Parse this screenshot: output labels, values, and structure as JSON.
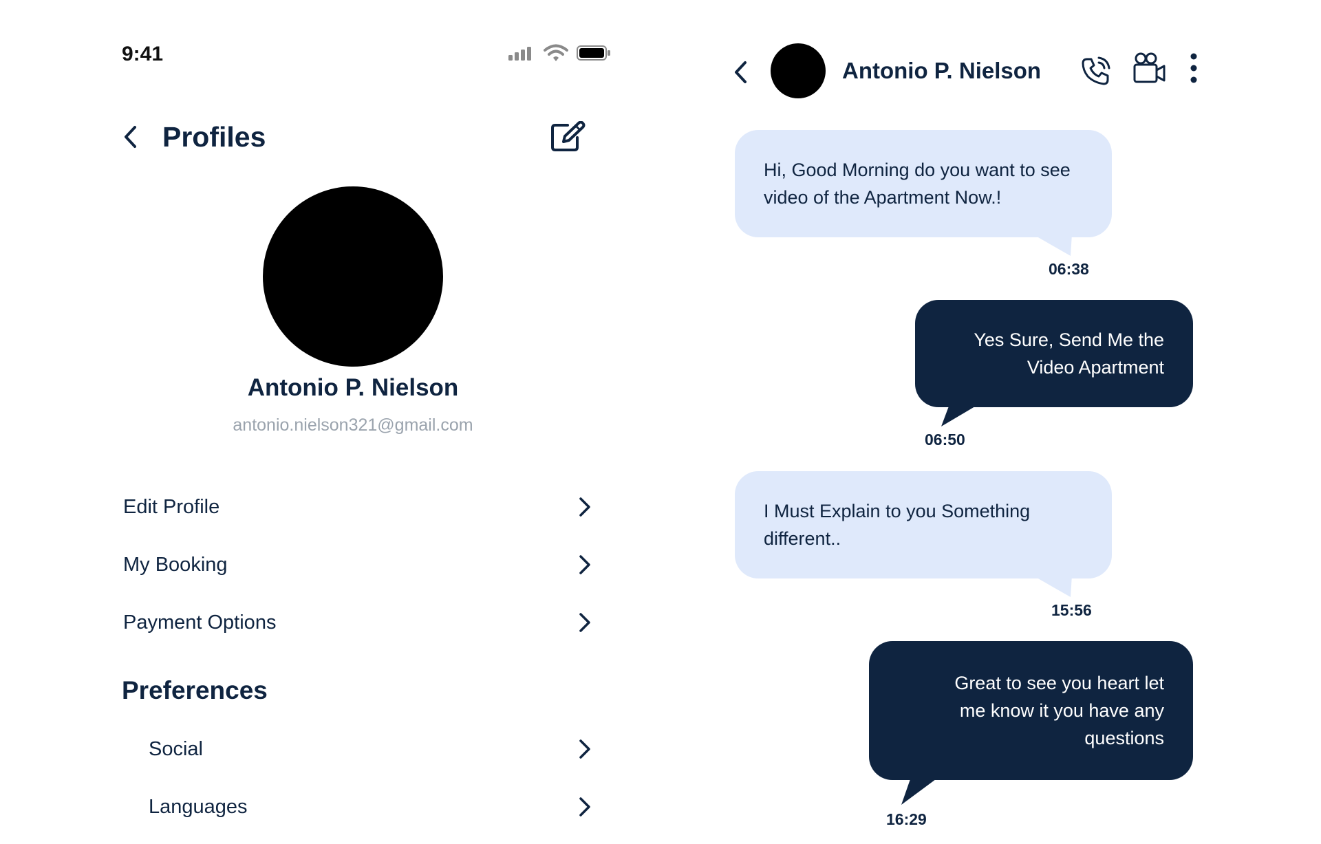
{
  "status_bar": {
    "time": "9:41"
  },
  "profile_screen": {
    "title": "Profiles",
    "name": "Antonio P. Nielson",
    "email": "antonio.nielson321@gmail.com",
    "menu": [
      {
        "label": "Edit Profile"
      },
      {
        "label": "My Booking"
      },
      {
        "label": "Payment Options"
      }
    ],
    "preferences": {
      "title": "Preferences",
      "items": [
        {
          "label": "Social"
        },
        {
          "label": "Languages"
        }
      ]
    }
  },
  "chat_screen": {
    "contact_name": "Antonio P. Nielson",
    "icons": [
      "back-icon",
      "phone-call-icon",
      "video-call-icon",
      "more-vertical-icon"
    ],
    "messages": [
      {
        "direction": "incoming",
        "lines": [
          "Hi, Good Morning do you want to see",
          "video of the Apartment Now.!"
        ],
        "time": "06:38"
      },
      {
        "direction": "outgoing",
        "lines": [
          "Yes Sure, Send Me the",
          "Video Apartment"
        ],
        "time": "06:50"
      },
      {
        "direction": "incoming",
        "lines": [
          "I Must Explain to you Something",
          "different.."
        ],
        "time": "15:56"
      },
      {
        "direction": "outgoing",
        "lines": [
          "Great to see you heart let",
          "me know it you have any",
          "questions"
        ],
        "time": "16:29"
      }
    ]
  },
  "colors": {
    "primary": "#0f2440",
    "incoming_bubble": "#dfe9fb",
    "muted_text": "#9aa3ad"
  }
}
